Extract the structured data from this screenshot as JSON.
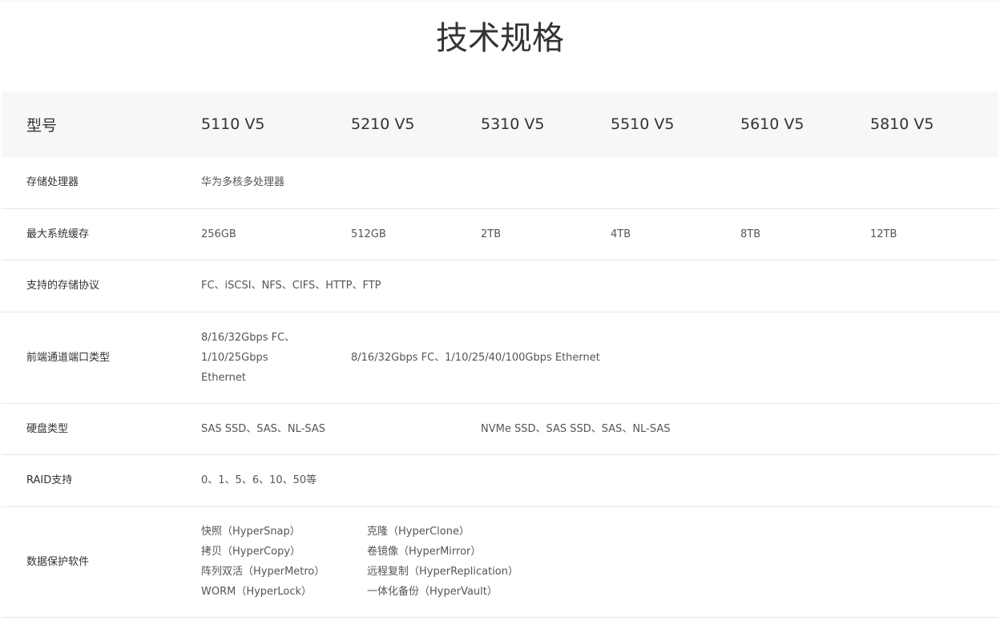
{
  "title": "技术规格",
  "header": {
    "label": "型号",
    "models": [
      "5110 V5",
      "5210 V5",
      "5310 V5",
      "5510 V5",
      "5610 V5",
      "5810 V5"
    ]
  },
  "rows": {
    "processor": {
      "label": "存储处理器",
      "value": "华为多核多处理器"
    },
    "cache": {
      "label": "最大系统缓存",
      "values": [
        "256GB",
        "512GB",
        "2TB",
        "4TB",
        "8TB",
        "12TB"
      ]
    },
    "protocols": {
      "label": "支持的存储协议",
      "value": "FC、iSCSI、NFS、CIFS、HTTP、FTP"
    },
    "frontend": {
      "label": "前端通道端口类型",
      "value_5110": [
        "8/16/32Gbps FC、",
        "1/10/25Gbps",
        "Ethernet"
      ],
      "value_rest": "8/16/32Gbps FC、1/10/25/40/100Gbps Ethernet"
    },
    "disk": {
      "label": "硬盘类型",
      "value_low": "SAS SSD、SAS、NL-SAS",
      "value_high": "NVMe SSD、SAS SSD、SAS、NL-SAS"
    },
    "raid": {
      "label": "RAID支持",
      "value": "0、1、5、6、10、50等"
    },
    "protection": {
      "label": "数据保护软件",
      "items": [
        "快照（HyperSnap）",
        "克隆（HyperClone）",
        "拷贝（HyperCopy）",
        "卷镜像（HyperMirror）",
        "阵列双活（HyperMetro）",
        "远程复制（HyperReplication）",
        "WORM（HyperLock）",
        "一体化备份（HyperVault）"
      ]
    }
  }
}
